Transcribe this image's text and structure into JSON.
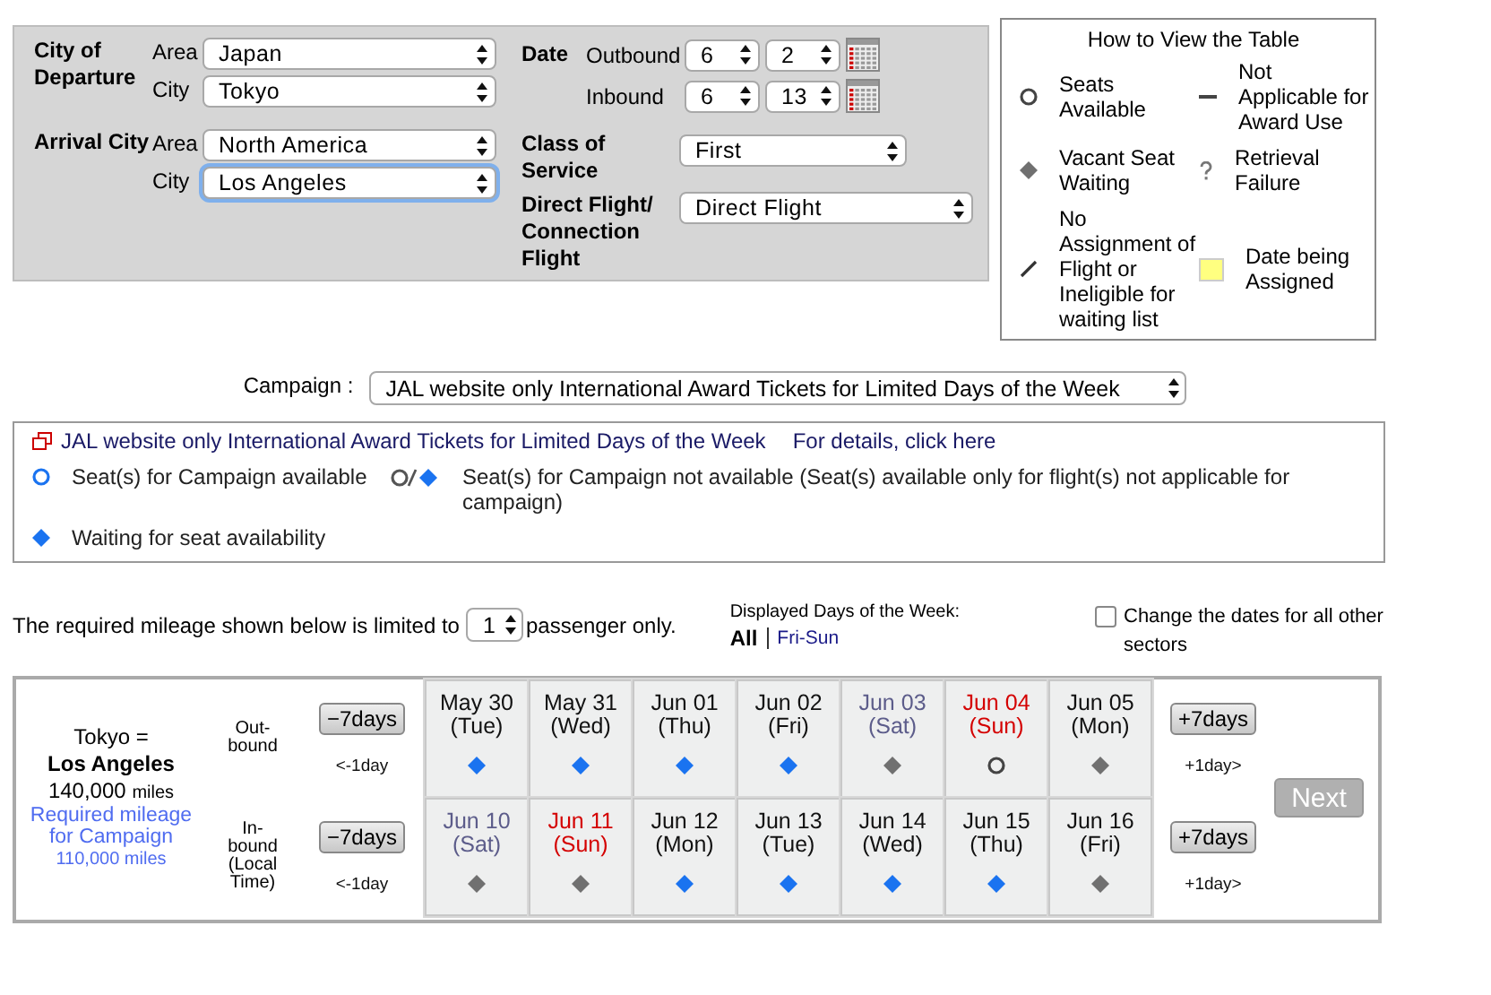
{
  "search_form": {
    "departure": {
      "label": "City of Departure",
      "area_label": "Area",
      "area": "Japan",
      "city_label": "City",
      "city": "Tokyo",
      "city_focused": false
    },
    "arrival": {
      "label": "Arrival City",
      "area_label": "Area",
      "area": "North America",
      "city_label": "City",
      "city": "Los Angeles",
      "city_focused": true
    },
    "date": {
      "label": "Date",
      "outbound_label": "Outbound",
      "outbound_month": "6",
      "outbound_day": "2",
      "inbound_label": "Inbound",
      "inbound_month": "6",
      "inbound_day": "13"
    },
    "class_of_service": {
      "label": "Class of Service",
      "value": "First"
    },
    "flight_type": {
      "label": "Direct Flight/ Connection Flight",
      "value": "Direct Flight"
    }
  },
  "legend": {
    "title": "How to View the Table",
    "items": [
      {
        "kind": "circle",
        "label": "Seats Available"
      },
      {
        "kind": "dash",
        "label": "Not Applicable for Award Use"
      },
      {
        "kind": "diamond",
        "label": "Vacant Seat Waiting"
      },
      {
        "kind": "question",
        "label": "Retrieval Failure"
      },
      {
        "kind": "slash",
        "label": "No Assignment of Flight or Ineligible for waiting list"
      },
      {
        "kind": "yellow",
        "label": "Date being Assigned"
      }
    ]
  },
  "campaign": {
    "label": "Campaign :",
    "value": "JAL website only International Award Tickets for Limited Days of the Week"
  },
  "campaign_box": {
    "title": "JAL website only International Award Tickets for Limited Days of the Week",
    "link": "For details, click here",
    "items": [
      {
        "kind": "blue_circle",
        "label": "Seat(s) for Campaign available"
      },
      {
        "kind": "circle_or_diamond",
        "label": "Seat(s) for Campaign not available (Seat(s) available only for flight(s) not applicable for campaign)"
      },
      {
        "kind": "blue_diamond",
        "label": "Waiting for seat availability"
      }
    ]
  },
  "mileage_note": {
    "before": "The required mileage shown below is limited to",
    "passengers": "1",
    "after": "passenger only."
  },
  "days_filter": {
    "label": "Displayed Days of the Week:",
    "options": [
      {
        "label": "All",
        "selected": true
      },
      {
        "label": "Fri-Sun",
        "selected": false
      }
    ]
  },
  "change_dates": {
    "label": "Change the dates for all other sectors",
    "checked": false
  },
  "table": {
    "route": {
      "from": "Tokyo =",
      "to": "Los Angeles",
      "miles": "140,000",
      "miles_unit": "miles",
      "campaign_label": "Required mileage for Campaign",
      "campaign_miles": "110,000 miles"
    },
    "directions": [
      {
        "label_lines": [
          "Out-",
          "bound"
        ],
        "minus7": "−7days",
        "minus1": "<-1day",
        "plus7": "+7days",
        "plus1": "+1day>",
        "days": [
          {
            "date": "May 30",
            "weekday": "(Tue)",
            "color": "#111111",
            "kind": "blue_diamond"
          },
          {
            "date": "May 31",
            "weekday": "(Wed)",
            "color": "#111111",
            "kind": "blue_diamond"
          },
          {
            "date": "Jun 01",
            "weekday": "(Thu)",
            "color": "#111111",
            "kind": "blue_diamond"
          },
          {
            "date": "Jun 02",
            "weekday": "(Fri)",
            "color": "#111111",
            "kind": "blue_diamond"
          },
          {
            "date": "Jun 03",
            "weekday": "(Sat)",
            "color": "#5c5c8a",
            "kind": "diamond"
          },
          {
            "date": "Jun 04",
            "weekday": "(Sun)",
            "color": "#d40000",
            "kind": "circle"
          },
          {
            "date": "Jun 05",
            "weekday": "(Mon)",
            "color": "#111111",
            "kind": "diamond"
          }
        ]
      },
      {
        "label_lines": [
          "In-",
          "bound",
          "(Local Time)"
        ],
        "minus7": "−7days",
        "minus1": "<-1day",
        "plus7": "+7days",
        "plus1": "+1day>",
        "days": [
          {
            "date": "Jun 10",
            "weekday": "(Sat)",
            "color": "#5c5c8a",
            "kind": "diamond"
          },
          {
            "date": "Jun 11",
            "weekday": "(Sun)",
            "color": "#d40000",
            "kind": "diamond"
          },
          {
            "date": "Jun 12",
            "weekday": "(Mon)",
            "color": "#111111",
            "kind": "blue_diamond"
          },
          {
            "date": "Jun 13",
            "weekday": "(Tue)",
            "color": "#111111",
            "kind": "blue_diamond"
          },
          {
            "date": "Jun 14",
            "weekday": "(Wed)",
            "color": "#111111",
            "kind": "blue_diamond"
          },
          {
            "date": "Jun 15",
            "weekday": "(Thu)",
            "color": "#111111",
            "kind": "blue_diamond"
          },
          {
            "date": "Jun 16",
            "weekday": "(Fri)",
            "color": "#111111",
            "kind": "diamond"
          }
        ]
      }
    ],
    "next_button": {
      "label": "Next",
      "disabled": true
    }
  }
}
